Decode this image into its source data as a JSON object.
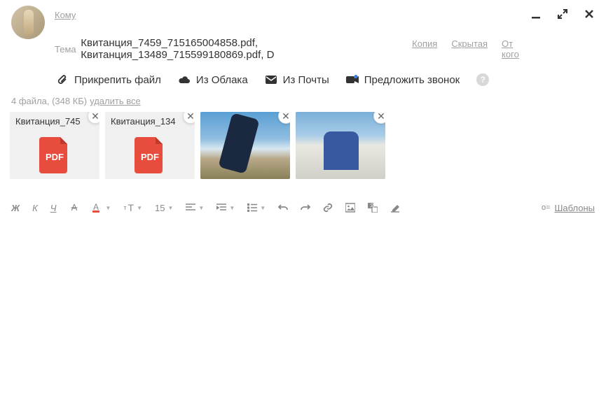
{
  "header": {
    "to_label": "Кому",
    "subject_label": "Тема",
    "subject_value": "Квитанция_7459_715165004858.pdf, Квитанция_13489_715599180869.pdf, D",
    "links": {
      "copy": "Копия",
      "bcc": "Скрытая",
      "from": "От кого"
    }
  },
  "attach_bar": {
    "attach_file": "Прикрепить файл",
    "from_cloud": "Из Облака",
    "from_mail": "Из Почты",
    "suggest_call": "Предложить звонок",
    "help": "?"
  },
  "files_info": {
    "count_text": "4 файла, (348 КБ)",
    "delete_all": "удалить все"
  },
  "attachments": [
    {
      "name": "Квитанция_745",
      "type": "pdf",
      "badge": "PDF"
    },
    {
      "name": "Квитанция_134",
      "type": "pdf",
      "badge": "PDF"
    },
    {
      "name": "",
      "type": "image1"
    },
    {
      "name": "",
      "type": "image2"
    }
  ],
  "toolbar": {
    "bold": "Ж",
    "italic": "К",
    "underline": "Ч",
    "font_size": "15",
    "templates": "Шаблоны"
  }
}
